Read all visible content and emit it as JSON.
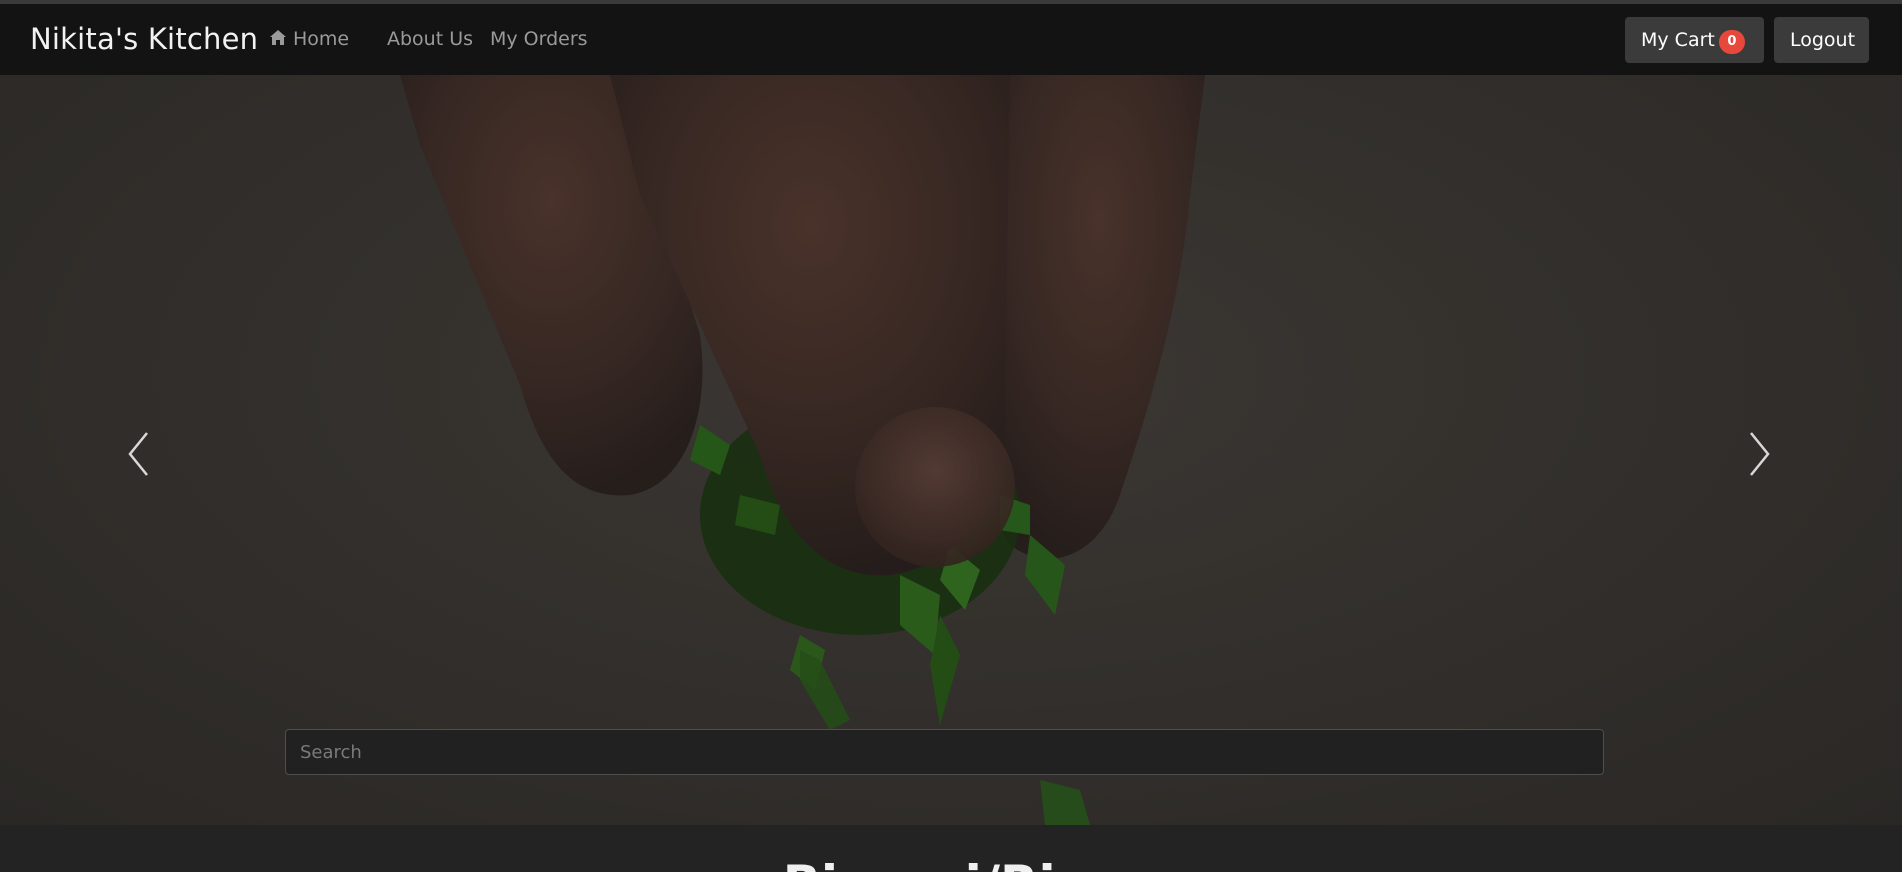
{
  "navbar": {
    "brand": "Nikita's Kitchen",
    "links": [
      {
        "label": "Home",
        "icon": "home-icon"
      },
      {
        "label": "About Us"
      },
      {
        "label": "My Orders"
      }
    ],
    "cart": {
      "label": "My Cart",
      "count": "0"
    },
    "logout_label": "Logout"
  },
  "hero": {
    "image": "hand sprinkling chopped green herbs",
    "prev_icon": "chevron-left-icon",
    "next_icon": "chevron-right-icon"
  },
  "search": {
    "placeholder": "Search",
    "value": ""
  },
  "section": {
    "title": "Biryani/Rice"
  },
  "colors": {
    "navbar_bg": "#131313",
    "button_bg": "#3b3b3b",
    "badge": "#e8483b",
    "page_bg": "#232323"
  }
}
